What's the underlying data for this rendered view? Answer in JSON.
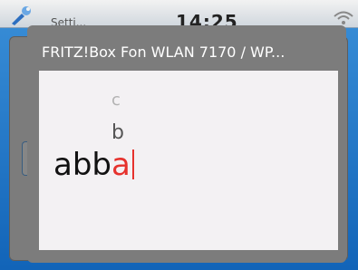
{
  "statusbar": {
    "app_label": "Setti...",
    "time": "14:25"
  },
  "dialog": {
    "title": "FRITZ!Box Fon WLAN 7170 / WP..."
  },
  "picker": {
    "upper_option": "c",
    "lower_option": "b"
  },
  "entry": {
    "confirmed_text": "abb",
    "current_char": "a"
  },
  "colors": {
    "accent": "#e6322d",
    "dialog_gray": "#7c7c7c",
    "content_bg": "#f3f1f3"
  },
  "icons": {
    "status_left": "wrench-icon",
    "status_right": "wifi-icon"
  }
}
